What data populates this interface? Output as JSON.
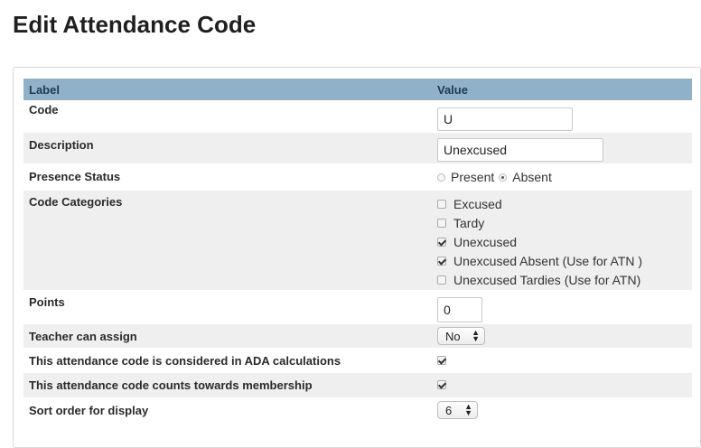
{
  "page": {
    "title": "Edit Attendance Code"
  },
  "table": {
    "header": {
      "label": "Label",
      "value": "Value"
    },
    "code": {
      "label": "Code",
      "value": "U"
    },
    "description": {
      "label": "Description",
      "value": "Unexcused"
    },
    "presence_status": {
      "label": "Presence Status",
      "options": [
        {
          "label": "Present",
          "selected": false
        },
        {
          "label": "Absent",
          "selected": true
        }
      ]
    },
    "code_categories": {
      "label": "Code Categories",
      "options": [
        {
          "label": "Excused",
          "checked": false
        },
        {
          "label": "Tardy",
          "checked": false
        },
        {
          "label": "Unexcused",
          "checked": true
        },
        {
          "label": "Unexcused Absent (Use for ATN )",
          "checked": true
        },
        {
          "label": "Unexcused Tardies (Use for ATN)",
          "checked": false
        }
      ]
    },
    "points": {
      "label": "Points",
      "value": "0"
    },
    "teacher_can_assign": {
      "label": "Teacher can assign",
      "value": "No"
    },
    "ada_calculations": {
      "label": "This attendance code is considered in ADA calculations",
      "checked": true
    },
    "membership": {
      "label": "This attendance code counts towards membership",
      "checked": true
    },
    "sort_order": {
      "label": "Sort order for display",
      "value": "6"
    }
  }
}
